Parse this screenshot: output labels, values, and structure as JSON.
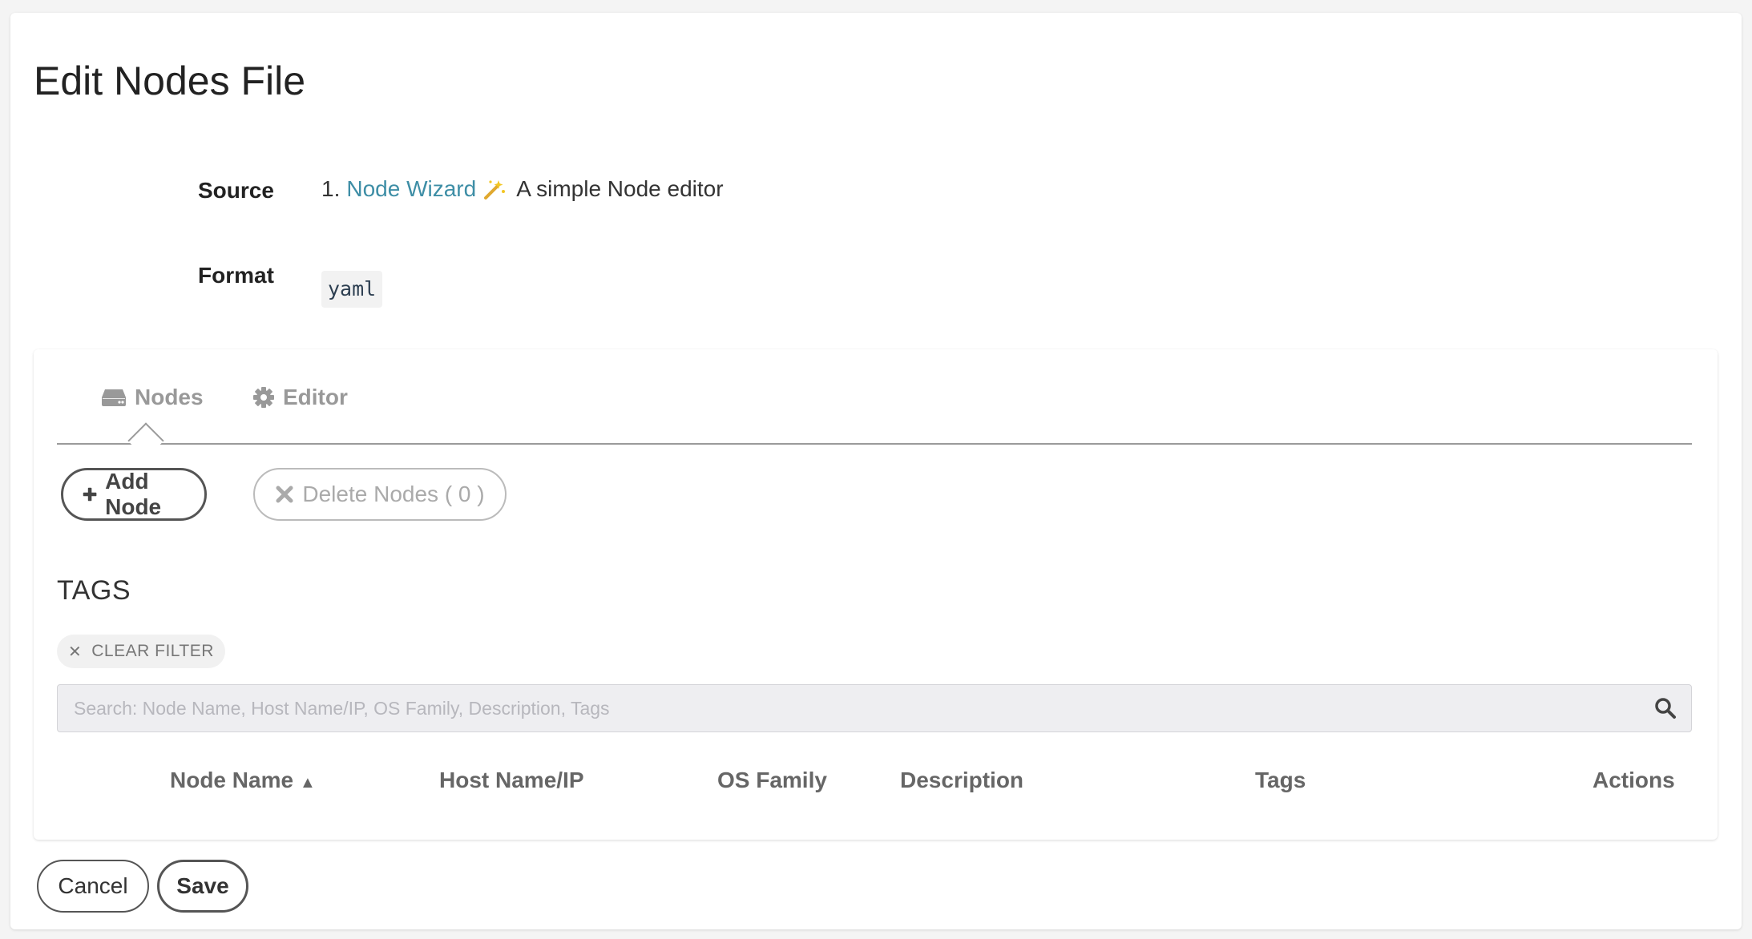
{
  "page": {
    "title": "Edit Nodes File"
  },
  "source": {
    "label": "Source",
    "number": "1.",
    "link_text": "Node Wizard",
    "icon": "magic-wand-icon",
    "description": "A simple Node editor"
  },
  "format": {
    "label": "Format",
    "value": "yaml"
  },
  "tabs": [
    {
      "label": "Nodes",
      "icon": "server-icon",
      "active": true
    },
    {
      "label": "Editor",
      "icon": "gear-icon",
      "active": false
    }
  ],
  "actions": {
    "add_node": "Add Node",
    "delete_nodes": "Delete Nodes ( 0 )"
  },
  "tags": {
    "heading": "TAGS",
    "clear_filter": "CLEAR FILTER"
  },
  "search": {
    "placeholder": "Search: Node Name, Host Name/IP, OS Family, Description, Tags",
    "value": ""
  },
  "table": {
    "columns": [
      "Node Name",
      "Host Name/IP",
      "OS Family",
      "Description",
      "Tags",
      "Actions"
    ],
    "sort_indicator": "▲",
    "rows": []
  },
  "footer": {
    "cancel": "Cancel",
    "save": "Save"
  },
  "colors": {
    "link": "#3e8ea6",
    "tab_text": "#999999",
    "button_border": "#555555",
    "search_bg": "#eeeef1"
  }
}
